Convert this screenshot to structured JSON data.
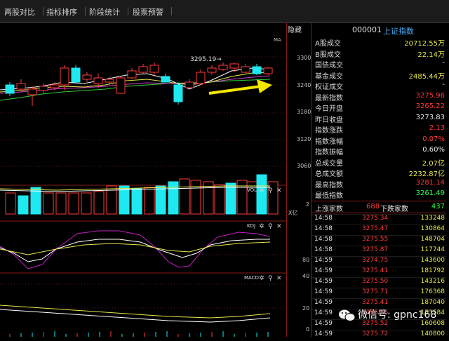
{
  "tabs": [
    "两股对比",
    "指标排序",
    "阶段统计",
    "股票预警"
  ],
  "hide_label": "隐藏",
  "stock": {
    "code": "000001",
    "name": "上证指数"
  },
  "panels": {
    "main": {
      "label": "MA",
      "high_marker": "3295.19→",
      "y_ticks": [
        "3300",
        "3240",
        "3180",
        "3120",
        "3060"
      ]
    },
    "vol": {
      "label": "VOL",
      "y_ticks": [
        "2"
      ],
      "unit": "X亿"
    },
    "kdj": {
      "label": "KDJ",
      "y_ticks": [
        "80",
        "40"
      ]
    },
    "macd": {
      "label": "MACD",
      "y_ticks": [
        "20",
        "0"
      ]
    }
  },
  "quote": [
    {
      "label": "A股成交",
      "value": "20712.55万",
      "color": "yellow"
    },
    {
      "label": "B股成交",
      "value": "22.14万",
      "color": "yellow"
    },
    {
      "label": "国债成交",
      "value": "-",
      "color": "white"
    },
    {
      "label": "基金成交",
      "value": "2485.44万",
      "color": "yellow"
    },
    {
      "label": "权证成交",
      "value": "-",
      "color": "white"
    },
    {
      "label": "最新指数",
      "value": "3275.96",
      "color": "red"
    },
    {
      "label": "今日开盘",
      "value": "3265.22",
      "color": "red"
    },
    {
      "label": "昨日收盘",
      "value": "3273.83",
      "color": "white"
    },
    {
      "label": "指数涨跌",
      "value": "2.13",
      "color": "red"
    },
    {
      "label": "指数涨幅",
      "value": "0.07%",
      "color": "red"
    },
    {
      "label": "指数振幅",
      "value": "0.60%",
      "color": "white"
    },
    {
      "label": "总成交量",
      "value": "2.07亿",
      "color": "yellow"
    },
    {
      "label": "总成交额",
      "value": "2232.87亿",
      "color": "yellow"
    },
    {
      "label": "最高指数",
      "value": "3281.14",
      "color": "red"
    },
    {
      "label": "最低指数",
      "value": "3261.49",
      "color": "green"
    }
  ],
  "breadth": {
    "up_label": "上涨家数",
    "up_value": "688",
    "down_label": "下跌家数",
    "down_value": "437"
  },
  "ticks": [
    {
      "time": "14:58",
      "price": "3275.34",
      "vol": "133248"
    },
    {
      "time": "14:58",
      "price": "3275.47",
      "vol": "130864"
    },
    {
      "time": "14:58",
      "price": "3275.55",
      "vol": "148704"
    },
    {
      "time": "14:58",
      "price": "3275.87",
      "vol": "117744"
    },
    {
      "time": "14:59",
      "price": "3274.75",
      "vol": "143600"
    },
    {
      "time": "14:59",
      "price": "3275.41",
      "vol": "181792"
    },
    {
      "time": "14:59",
      "price": "3275.50",
      "vol": "143216"
    },
    {
      "time": "14:59",
      "price": "3275.71",
      "vol": "176368"
    },
    {
      "time": "14:59",
      "price": "3275.41",
      "vol": "187040"
    },
    {
      "time": "14:59",
      "price": "3275.56",
      "vol": "153584"
    },
    {
      "time": "14:59",
      "price": "3275.52",
      "vol": "160608"
    },
    {
      "time": "14:59",
      "price": "3275.72",
      "vol": "140800"
    }
  ],
  "watermark": "微信号: gpnc168",
  "colors": {
    "up": "#ff3a3a",
    "down": "#1ee8f0",
    "ma5": "#ffffff",
    "ma10": "#e8e84a",
    "ma20": "#d040d0",
    "ma60": "#30d030",
    "arrow": "#f5e600",
    "divider": "#8a1a1a"
  }
}
